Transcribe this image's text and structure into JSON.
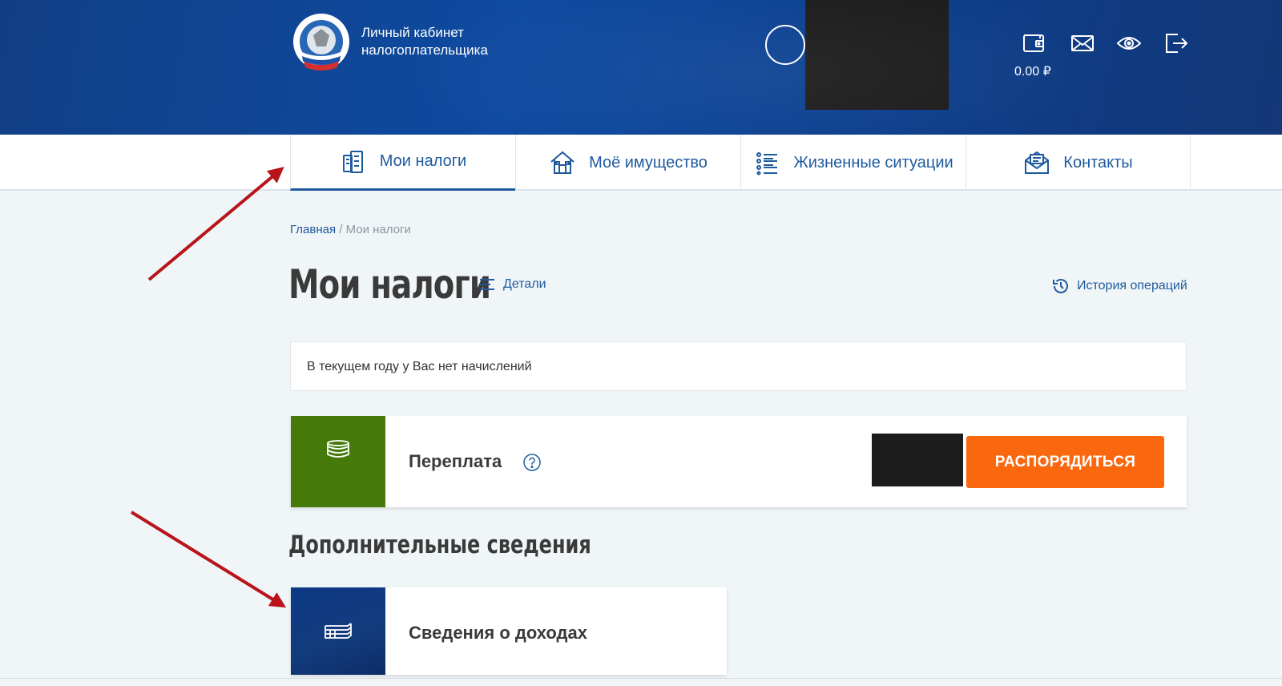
{
  "header": {
    "brand_line1": "Личный кабинет",
    "brand_line2": "налогоплательщика",
    "balance": "0.00 ₽",
    "icons": [
      "wallet-icon",
      "mail-icon",
      "eye-icon",
      "exit-icon"
    ]
  },
  "nav": {
    "tabs": [
      {
        "label": "Мои налоги",
        "icon": "tax-documents-icon",
        "active": true
      },
      {
        "label": "Моё имущество",
        "icon": "property-icon",
        "active": false
      },
      {
        "label": "Жизненные ситуации",
        "icon": "list-icon",
        "active": false
      },
      {
        "label": "Контакты",
        "icon": "contacts-icon",
        "active": false
      }
    ]
  },
  "breadcrumb": {
    "home": "Главная",
    "separator": " / ",
    "current": "Мои налоги"
  },
  "page": {
    "title": "Мои налоги",
    "details_label": "Детали",
    "history_label": "История операций",
    "notice": "В текущем году у Вас нет начислений"
  },
  "overpayment": {
    "title": "Переплата",
    "action_label": "РАСПОРЯДИТЬСЯ"
  },
  "additional": {
    "section_title": "Дополнительные сведения",
    "income_title": "Сведения о доходах"
  },
  "colors": {
    "header_blue": "#0e4aa0",
    "link_blue": "#1f5a9e",
    "overpay_green": "#457a0a",
    "action_orange": "#f9670f",
    "annotation_red": "#b8141a"
  }
}
